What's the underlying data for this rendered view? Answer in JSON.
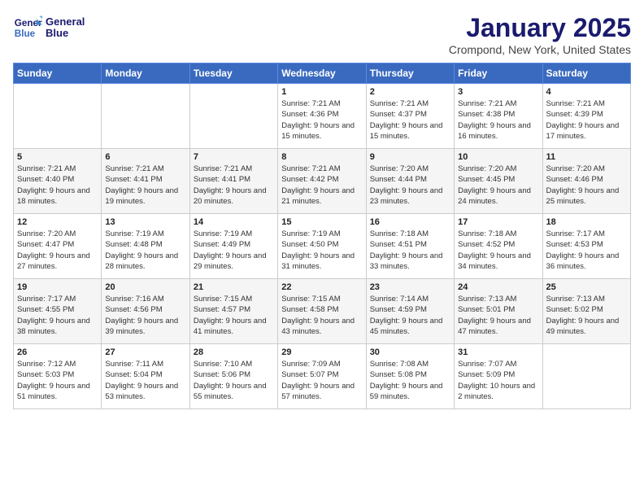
{
  "header": {
    "logo_line1": "General",
    "logo_line2": "Blue",
    "month": "January 2025",
    "location": "Crompond, New York, United States"
  },
  "days_of_week": [
    "Sunday",
    "Monday",
    "Tuesday",
    "Wednesday",
    "Thursday",
    "Friday",
    "Saturday"
  ],
  "weeks": [
    [
      {
        "day": "",
        "sunrise": "",
        "sunset": "",
        "daylight": ""
      },
      {
        "day": "",
        "sunrise": "",
        "sunset": "",
        "daylight": ""
      },
      {
        "day": "",
        "sunrise": "",
        "sunset": "",
        "daylight": ""
      },
      {
        "day": "1",
        "sunrise": "Sunrise: 7:21 AM",
        "sunset": "Sunset: 4:36 PM",
        "daylight": "Daylight: 9 hours and 15 minutes."
      },
      {
        "day": "2",
        "sunrise": "Sunrise: 7:21 AM",
        "sunset": "Sunset: 4:37 PM",
        "daylight": "Daylight: 9 hours and 15 minutes."
      },
      {
        "day": "3",
        "sunrise": "Sunrise: 7:21 AM",
        "sunset": "Sunset: 4:38 PM",
        "daylight": "Daylight: 9 hours and 16 minutes."
      },
      {
        "day": "4",
        "sunrise": "Sunrise: 7:21 AM",
        "sunset": "Sunset: 4:39 PM",
        "daylight": "Daylight: 9 hours and 17 minutes."
      }
    ],
    [
      {
        "day": "5",
        "sunrise": "Sunrise: 7:21 AM",
        "sunset": "Sunset: 4:40 PM",
        "daylight": "Daylight: 9 hours and 18 minutes."
      },
      {
        "day": "6",
        "sunrise": "Sunrise: 7:21 AM",
        "sunset": "Sunset: 4:41 PM",
        "daylight": "Daylight: 9 hours and 19 minutes."
      },
      {
        "day": "7",
        "sunrise": "Sunrise: 7:21 AM",
        "sunset": "Sunset: 4:41 PM",
        "daylight": "Daylight: 9 hours and 20 minutes."
      },
      {
        "day": "8",
        "sunrise": "Sunrise: 7:21 AM",
        "sunset": "Sunset: 4:42 PM",
        "daylight": "Daylight: 9 hours and 21 minutes."
      },
      {
        "day": "9",
        "sunrise": "Sunrise: 7:20 AM",
        "sunset": "Sunset: 4:44 PM",
        "daylight": "Daylight: 9 hours and 23 minutes."
      },
      {
        "day": "10",
        "sunrise": "Sunrise: 7:20 AM",
        "sunset": "Sunset: 4:45 PM",
        "daylight": "Daylight: 9 hours and 24 minutes."
      },
      {
        "day": "11",
        "sunrise": "Sunrise: 7:20 AM",
        "sunset": "Sunset: 4:46 PM",
        "daylight": "Daylight: 9 hours and 25 minutes."
      }
    ],
    [
      {
        "day": "12",
        "sunrise": "Sunrise: 7:20 AM",
        "sunset": "Sunset: 4:47 PM",
        "daylight": "Daylight: 9 hours and 27 minutes."
      },
      {
        "day": "13",
        "sunrise": "Sunrise: 7:19 AM",
        "sunset": "Sunset: 4:48 PM",
        "daylight": "Daylight: 9 hours and 28 minutes."
      },
      {
        "day": "14",
        "sunrise": "Sunrise: 7:19 AM",
        "sunset": "Sunset: 4:49 PM",
        "daylight": "Daylight: 9 hours and 29 minutes."
      },
      {
        "day": "15",
        "sunrise": "Sunrise: 7:19 AM",
        "sunset": "Sunset: 4:50 PM",
        "daylight": "Daylight: 9 hours and 31 minutes."
      },
      {
        "day": "16",
        "sunrise": "Sunrise: 7:18 AM",
        "sunset": "Sunset: 4:51 PM",
        "daylight": "Daylight: 9 hours and 33 minutes."
      },
      {
        "day": "17",
        "sunrise": "Sunrise: 7:18 AM",
        "sunset": "Sunset: 4:52 PM",
        "daylight": "Daylight: 9 hours and 34 minutes."
      },
      {
        "day": "18",
        "sunrise": "Sunrise: 7:17 AM",
        "sunset": "Sunset: 4:53 PM",
        "daylight": "Daylight: 9 hours and 36 minutes."
      }
    ],
    [
      {
        "day": "19",
        "sunrise": "Sunrise: 7:17 AM",
        "sunset": "Sunset: 4:55 PM",
        "daylight": "Daylight: 9 hours and 38 minutes."
      },
      {
        "day": "20",
        "sunrise": "Sunrise: 7:16 AM",
        "sunset": "Sunset: 4:56 PM",
        "daylight": "Daylight: 9 hours and 39 minutes."
      },
      {
        "day": "21",
        "sunrise": "Sunrise: 7:15 AM",
        "sunset": "Sunset: 4:57 PM",
        "daylight": "Daylight: 9 hours and 41 minutes."
      },
      {
        "day": "22",
        "sunrise": "Sunrise: 7:15 AM",
        "sunset": "Sunset: 4:58 PM",
        "daylight": "Daylight: 9 hours and 43 minutes."
      },
      {
        "day": "23",
        "sunrise": "Sunrise: 7:14 AM",
        "sunset": "Sunset: 4:59 PM",
        "daylight": "Daylight: 9 hours and 45 minutes."
      },
      {
        "day": "24",
        "sunrise": "Sunrise: 7:13 AM",
        "sunset": "Sunset: 5:01 PM",
        "daylight": "Daylight: 9 hours and 47 minutes."
      },
      {
        "day": "25",
        "sunrise": "Sunrise: 7:13 AM",
        "sunset": "Sunset: 5:02 PM",
        "daylight": "Daylight: 9 hours and 49 minutes."
      }
    ],
    [
      {
        "day": "26",
        "sunrise": "Sunrise: 7:12 AM",
        "sunset": "Sunset: 5:03 PM",
        "daylight": "Daylight: 9 hours and 51 minutes."
      },
      {
        "day": "27",
        "sunrise": "Sunrise: 7:11 AM",
        "sunset": "Sunset: 5:04 PM",
        "daylight": "Daylight: 9 hours and 53 minutes."
      },
      {
        "day": "28",
        "sunrise": "Sunrise: 7:10 AM",
        "sunset": "Sunset: 5:06 PM",
        "daylight": "Daylight: 9 hours and 55 minutes."
      },
      {
        "day": "29",
        "sunrise": "Sunrise: 7:09 AM",
        "sunset": "Sunset: 5:07 PM",
        "daylight": "Daylight: 9 hours and 57 minutes."
      },
      {
        "day": "30",
        "sunrise": "Sunrise: 7:08 AM",
        "sunset": "Sunset: 5:08 PM",
        "daylight": "Daylight: 9 hours and 59 minutes."
      },
      {
        "day": "31",
        "sunrise": "Sunrise: 7:07 AM",
        "sunset": "Sunset: 5:09 PM",
        "daylight": "Daylight: 10 hours and 2 minutes."
      },
      {
        "day": "",
        "sunrise": "",
        "sunset": "",
        "daylight": ""
      }
    ]
  ]
}
